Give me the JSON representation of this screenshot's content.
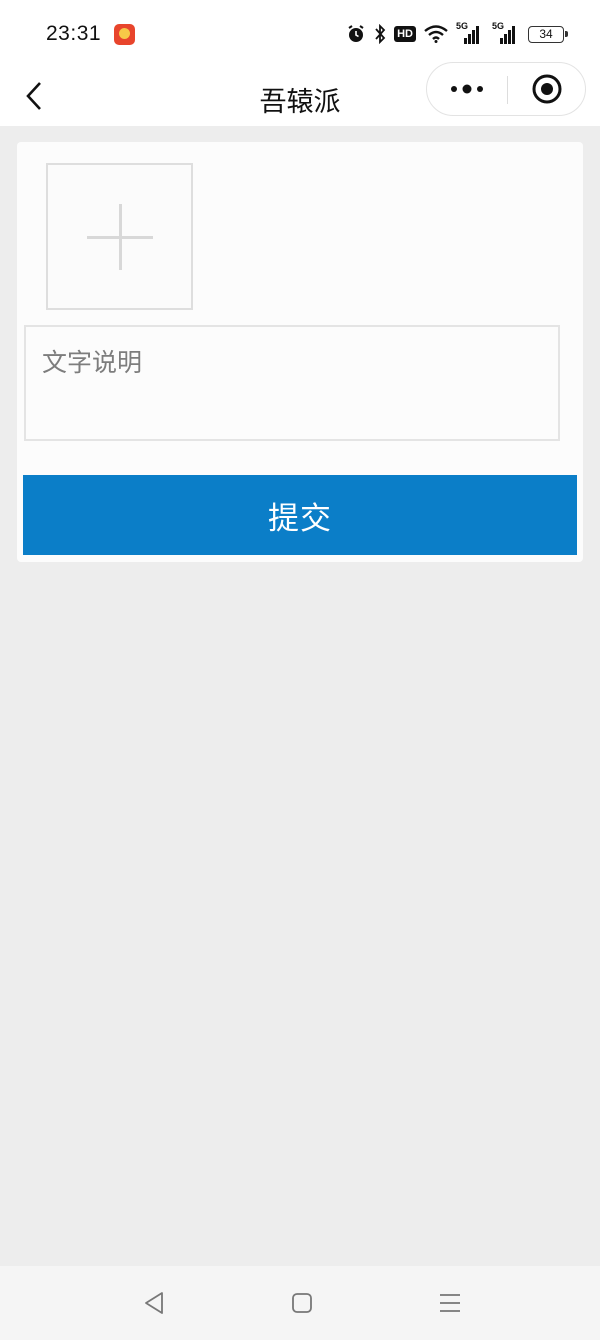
{
  "status_bar": {
    "time": "23:31",
    "app_icon": "app-notification-icon",
    "icons": [
      "alarm-icon",
      "bluetooth-icon",
      "hd-voice-icon",
      "wifi-icon",
      "signal-5g-icon",
      "signal-5g-icon-2",
      "battery-icon"
    ],
    "hd_label": "HD",
    "network_label_1": "5G",
    "network_label_2": "5G",
    "battery_level": "34"
  },
  "nav": {
    "title": "吾辕派",
    "back_icon": "chevron-left-icon",
    "more_icon": "more-dots-icon",
    "close_icon": "target-close-icon"
  },
  "form": {
    "upload_icon": "plus-icon",
    "description_placeholder": "文字说明",
    "description_value": "",
    "submit_label": "提交",
    "accent_color": "#0b7ec8"
  },
  "system_nav": {
    "back_icon": "triangle-back-icon",
    "home_icon": "square-home-icon",
    "menu_icon": "menu-lines-icon"
  }
}
